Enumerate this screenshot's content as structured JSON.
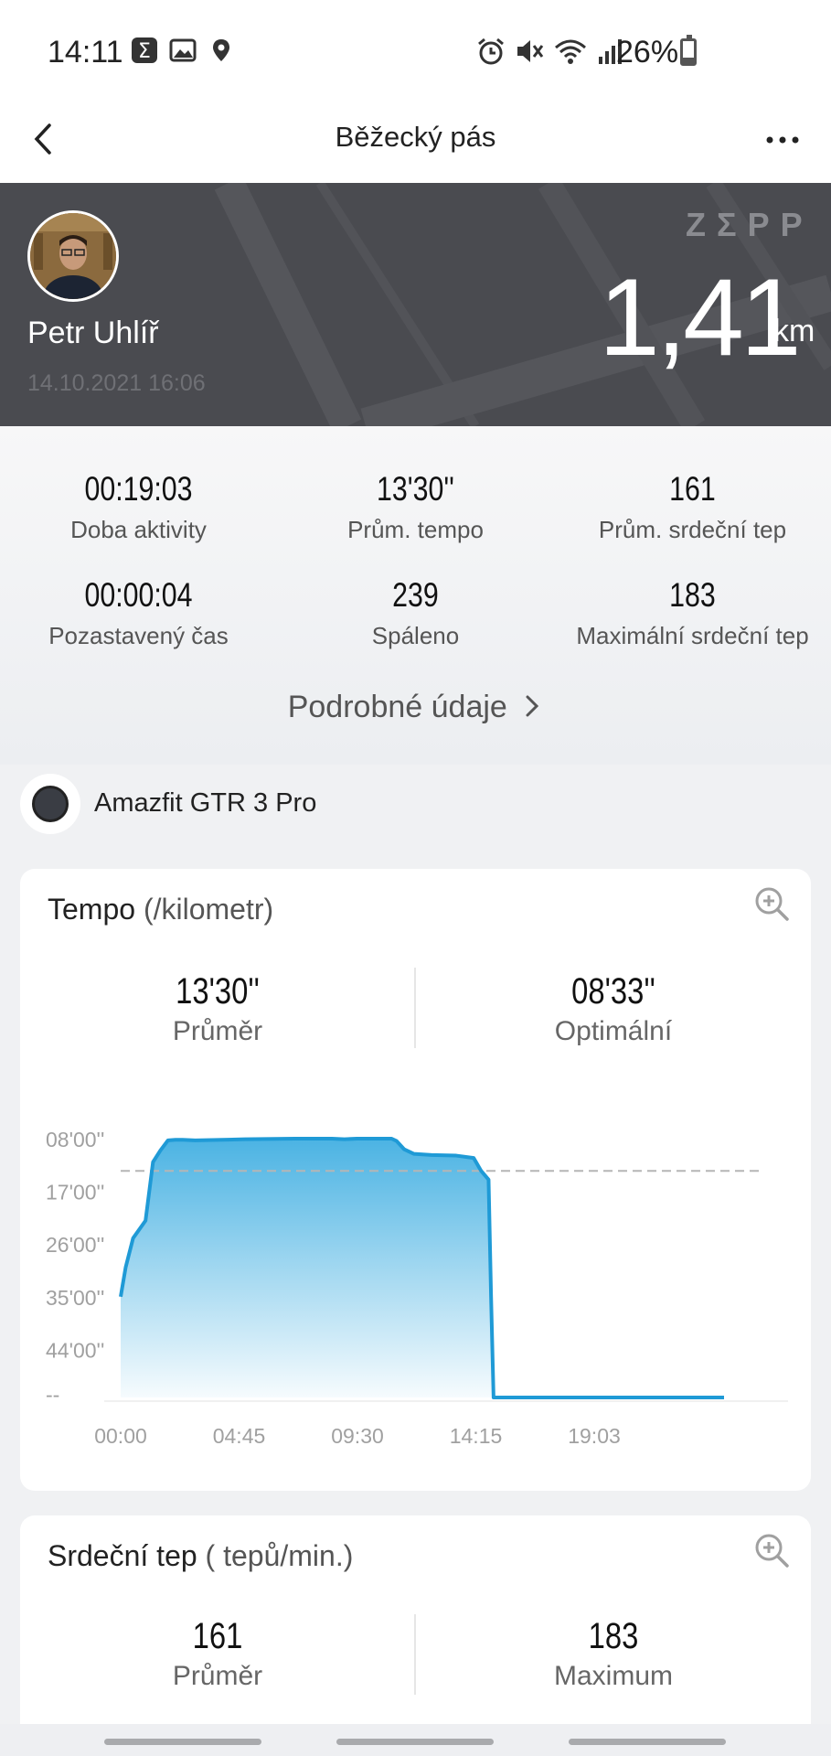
{
  "status_bar": {
    "time": "14:11",
    "battery": "26%",
    "battery_level": 0.26,
    "left_icons": [
      "sigma-icon",
      "image-icon",
      "location-icon"
    ],
    "right_icons": [
      "alarm-icon",
      "mute-icon",
      "wifi-icon",
      "signal-icon"
    ]
  },
  "nav": {
    "title": "Běžecký pás",
    "back_icon": "chevron-left-icon",
    "more_icon": "more-icon"
  },
  "hero": {
    "brand": "ZΣPP",
    "user_name": "Petr Uhlíř",
    "date": "14.10.2021 16:06",
    "distance": "1,41",
    "unit": "km"
  },
  "stats": [
    {
      "value": "00:19:03",
      "label": "Doba aktivity"
    },
    {
      "value": "13'30''",
      "label": "Prům. tempo"
    },
    {
      "value": "161",
      "label": "Prům. srdeční tep"
    },
    {
      "value": "00:00:04",
      "label": "Pozastavený čas"
    },
    {
      "value": "239",
      "label": "Spáleno"
    },
    {
      "value": "183",
      "label": "Maximální srdeční tep"
    }
  ],
  "details_link": "Podrobné údaje",
  "device": {
    "name": "Amazfit GTR 3 Pro"
  },
  "tempo_card": {
    "title": "Tempo",
    "unit": "(/kilometr)",
    "avg_value": "13'30''",
    "avg_label": "Průměr",
    "best_value": "08'33''",
    "best_label": "Optimální"
  },
  "heart_card": {
    "title": "Srdeční tep",
    "unit": "( tepů/min.)",
    "avg_value": "161",
    "avg_label": "Průměr",
    "max_value": "183",
    "max_label": "Maximum"
  },
  "chart_data": {
    "type": "area",
    "title": "Tempo (/kilometr)",
    "xlabel": "",
    "ylabel": "",
    "x_ticks": [
      "00:00",
      "04:45",
      "09:30",
      "14:15",
      "19:03"
    ],
    "y_ticks": [
      "08'00''",
      "17'00''",
      "26'00''",
      "35'00''",
      "44'00''",
      "--"
    ],
    "y_axis_reversed": true,
    "average_line_min": 13.5,
    "x_minutes": [
      0,
      0.2,
      0.5,
      1.0,
      1.3,
      1.6,
      1.9,
      2.2,
      2.5,
      3.0,
      5.0,
      7.0,
      8.5,
      9.0,
      9.5,
      10.0,
      10.5,
      10.9,
      11.1,
      11.4,
      11.8,
      12.5,
      13.5,
      14.2,
      14.5,
      14.8,
      14.9,
      15.0,
      19.05
    ],
    "pace_min_per_km": [
      35.0,
      30.0,
      25.0,
      22.0,
      12.0,
      10.0,
      8.3,
      8.2,
      8.2,
      8.3,
      8.1,
      8.0,
      8.0,
      8.1,
      8.0,
      8.0,
      8.0,
      8.0,
      8.4,
      9.8,
      10.6,
      10.8,
      10.9,
      11.3,
      13.5,
      15.0,
      35.0,
      null,
      null
    ],
    "grid": false,
    "legend": "none"
  }
}
